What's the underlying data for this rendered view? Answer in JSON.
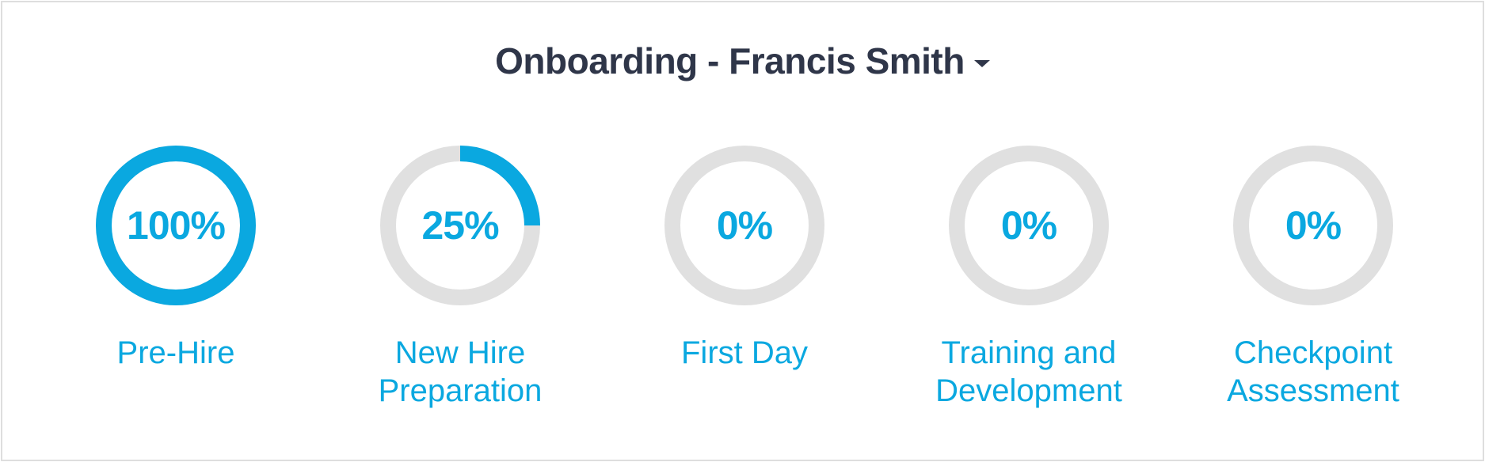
{
  "header": {
    "title": "Onboarding - Francis Smith",
    "dropdown_icon": "caret-down-icon"
  },
  "colors": {
    "accent": "#0aa8e0",
    "track": "#e0e0e0",
    "title": "#2f3649",
    "border": "#dedede"
  },
  "stages": [
    {
      "percent_label": "100%",
      "progress": 1.0,
      "label": "Pre-Hire"
    },
    {
      "percent_label": "25%",
      "progress": 0.25,
      "label": "New Hire\nPreparation"
    },
    {
      "percent_label": "0%",
      "progress": 0.0,
      "label": "First Day"
    },
    {
      "percent_label": "0%",
      "progress": 0.0,
      "label": "Training and\nDevelopment"
    },
    {
      "percent_label": "0%",
      "progress": 0.0,
      "label": "Checkpoint\nAssessment"
    }
  ]
}
